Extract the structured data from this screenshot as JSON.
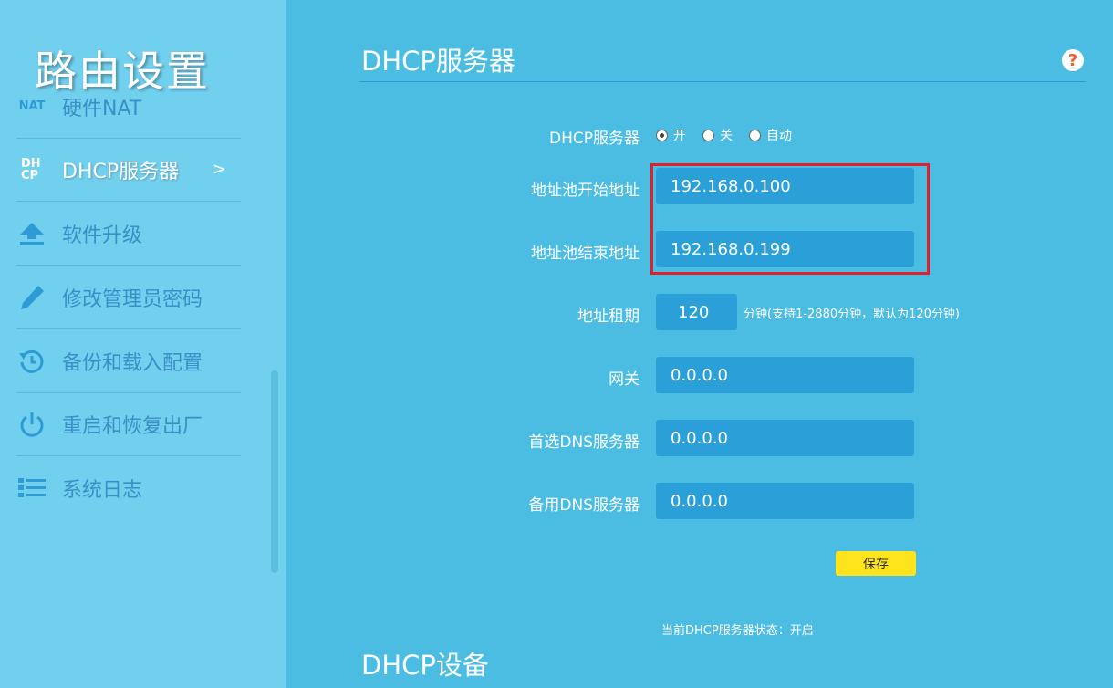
{
  "sidebar": {
    "title": "路由设置",
    "items": [
      {
        "label": "硬件NAT",
        "icon": "nat-icon",
        "icon_text": "NAT"
      },
      {
        "label": "DHCP服务器",
        "icon": "dhcp-icon",
        "icon_text": "DH CP",
        "arrow": ">"
      },
      {
        "label": "软件升级",
        "icon": "upload-icon"
      },
      {
        "label": "修改管理员密码",
        "icon": "pencil-icon"
      },
      {
        "label": "备份和载入配置",
        "icon": "history-icon"
      },
      {
        "label": "重启和恢复出厂",
        "icon": "power-icon"
      },
      {
        "label": "系统日志",
        "icon": "list-icon"
      }
    ]
  },
  "main": {
    "section_title": "DHCP服务器",
    "help": "?",
    "dhcp_server": {
      "label": "DHCP服务器",
      "options": [
        "开",
        "关",
        "自动"
      ],
      "selected": "开"
    },
    "pool_start": {
      "label": "地址池开始地址",
      "value": "192.168.0.100"
    },
    "pool_end": {
      "label": "地址池结束地址",
      "value": "192.168.0.199"
    },
    "lease": {
      "label": "地址租期",
      "value": "120",
      "hint": "分钟(支持1-2880分钟，默认为120分钟)"
    },
    "gateway": {
      "label": "网关",
      "value": "0.0.0.0"
    },
    "dns_primary": {
      "label": "首选DNS服务器",
      "value": "0.0.0.0"
    },
    "dns_secondary": {
      "label": "备用DNS服务器",
      "value": "0.0.0.0"
    },
    "save_label": "保存",
    "status": "当前DHCP服务器状态：开启",
    "devices_title": "DHCP设备"
  },
  "colors": {
    "main_bg": "#4bbde2",
    "sidebar_bg": "#72d0ef",
    "field_bg": "#2ba0d8",
    "highlight": "#e3202a",
    "save_button": "#fde41c"
  }
}
